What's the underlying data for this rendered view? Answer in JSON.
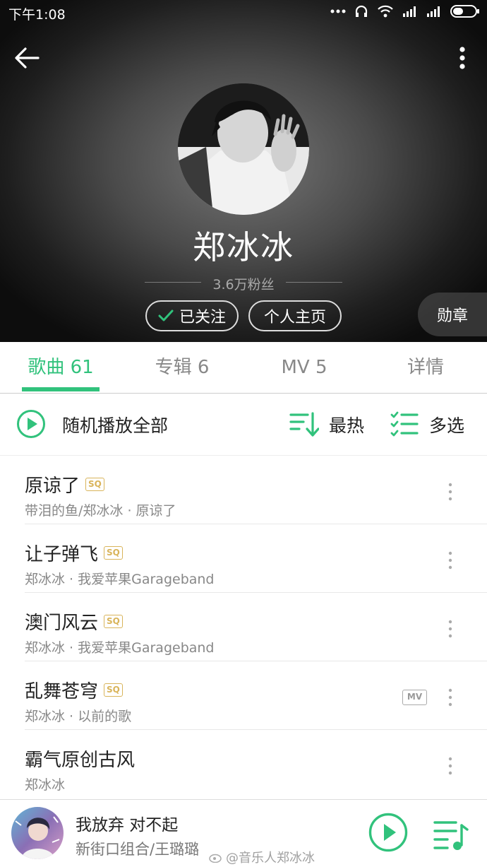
{
  "status": {
    "time": "下午1:08"
  },
  "header": {
    "artist_name": "郑冰冰",
    "fans": "3.6万粉丝",
    "follow_label": "已关注",
    "homepage_label": "个人主页",
    "medal_label": "勋章"
  },
  "tabs": [
    {
      "label": "歌曲 61",
      "active": true
    },
    {
      "label": "专辑 6",
      "active": false
    },
    {
      "label": "MV 5",
      "active": false
    },
    {
      "label": "详情",
      "active": false
    }
  ],
  "actions": {
    "shuffle_label": "随机播放全部",
    "sort_label": "最热",
    "multi_label": "多选"
  },
  "songs": [
    {
      "title": "原谅了",
      "quality": "SQ",
      "subtitle": "带泪的鱼/郑冰冰 · 原谅了",
      "mv": ""
    },
    {
      "title": "让子弹飞",
      "quality": "SQ",
      "subtitle": "郑冰冰 · 我爱苹果Garageband",
      "mv": ""
    },
    {
      "title": "澳门风云",
      "quality": "SQ",
      "subtitle": "郑冰冰 · 我爱苹果Garageband",
      "mv": ""
    },
    {
      "title": "乱舞苍穹",
      "quality": "SQ",
      "subtitle": "郑冰冰 · 以前的歌",
      "mv": "MV"
    },
    {
      "title": "霸气原创古风",
      "quality": "",
      "subtitle": "郑冰冰",
      "mv": ""
    }
  ],
  "player": {
    "title": "我放弃 对不起",
    "artist": "新街口组合/王璐璐",
    "watermark": "@音乐人郑冰冰"
  },
  "colors": {
    "accent": "#31c27c",
    "sq_gold": "#d9b45a"
  }
}
